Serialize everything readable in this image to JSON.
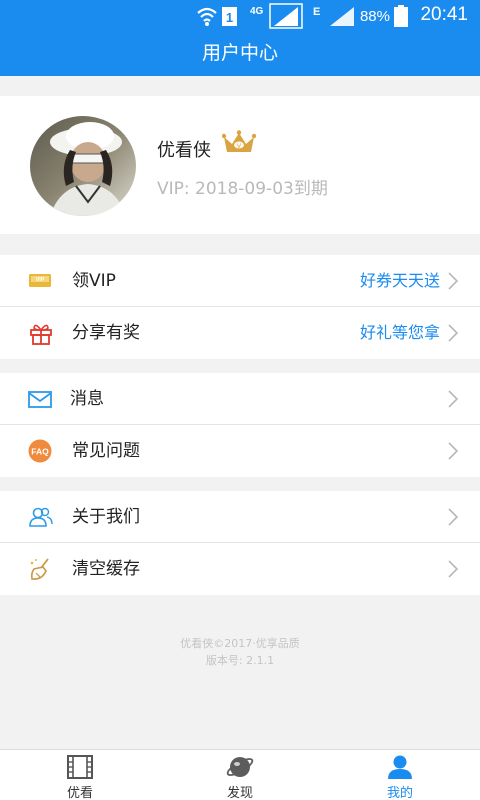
{
  "status_bar": {
    "time": "20:41",
    "battery_percent": "88%",
    "network": "4G",
    "network_secondary": "E",
    "sim_slot": "1"
  },
  "header": {
    "title": "用户中心"
  },
  "profile": {
    "username": "优看侠",
    "vip_expiry": "VIP: 2018-09-03到期"
  },
  "menu": {
    "group1": [
      {
        "label": "领VIP",
        "right_text": "好券天天送",
        "icon": "vip-card-icon"
      },
      {
        "label": "分享有奖",
        "right_text": "好礼等您拿",
        "icon": "gift-icon"
      }
    ],
    "group2": [
      {
        "label": "消息",
        "icon": "mail-icon"
      },
      {
        "label": "常见问题",
        "icon": "faq-icon"
      }
    ],
    "group3": [
      {
        "label": "关于我们",
        "icon": "people-icon"
      },
      {
        "label": "清空缓存",
        "icon": "broom-icon"
      }
    ]
  },
  "footer": {
    "copyright": "优看侠©2017·优享品质",
    "version": "版本号: 2.1.1"
  },
  "tabs": [
    {
      "label": "优看",
      "icon": "film-icon",
      "active": false
    },
    {
      "label": "发现",
      "icon": "planet-icon",
      "active": false
    },
    {
      "label": "我的",
      "icon": "user-icon",
      "active": true
    }
  ],
  "colors": {
    "primary": "#1a8cf0",
    "background": "#f2f2f2",
    "vip_text": "#b9b9b9",
    "crown": "#d9a441"
  }
}
